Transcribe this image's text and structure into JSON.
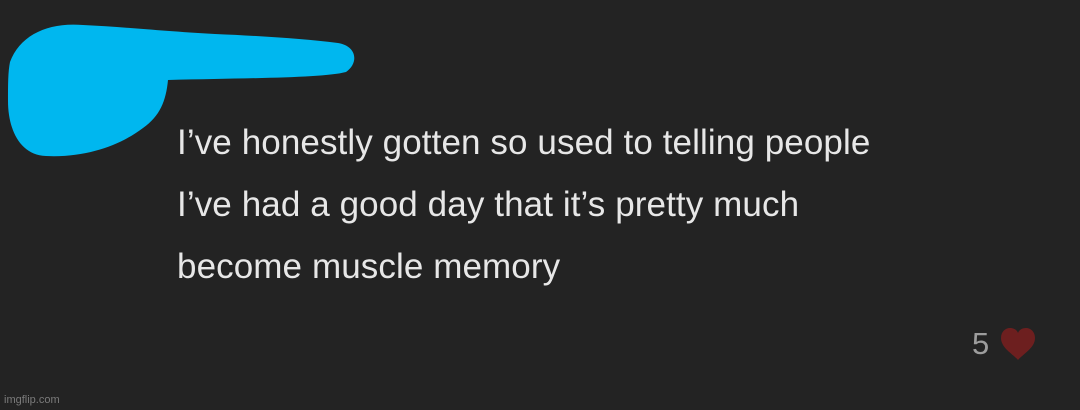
{
  "comment": {
    "lines": [
      "I’ve honestly gotten so used to telling people",
      "I’ve had a good day that it’s pretty much",
      "become muscle memory"
    ]
  },
  "reactions": {
    "like_count": "5",
    "icon": "heart-icon"
  },
  "watermark": {
    "text": "imgflip.com"
  },
  "colors": {
    "background": "#232323",
    "text": "#e7e7e7",
    "redaction": "#00b7ef",
    "heart": "#6d1f1f"
  }
}
